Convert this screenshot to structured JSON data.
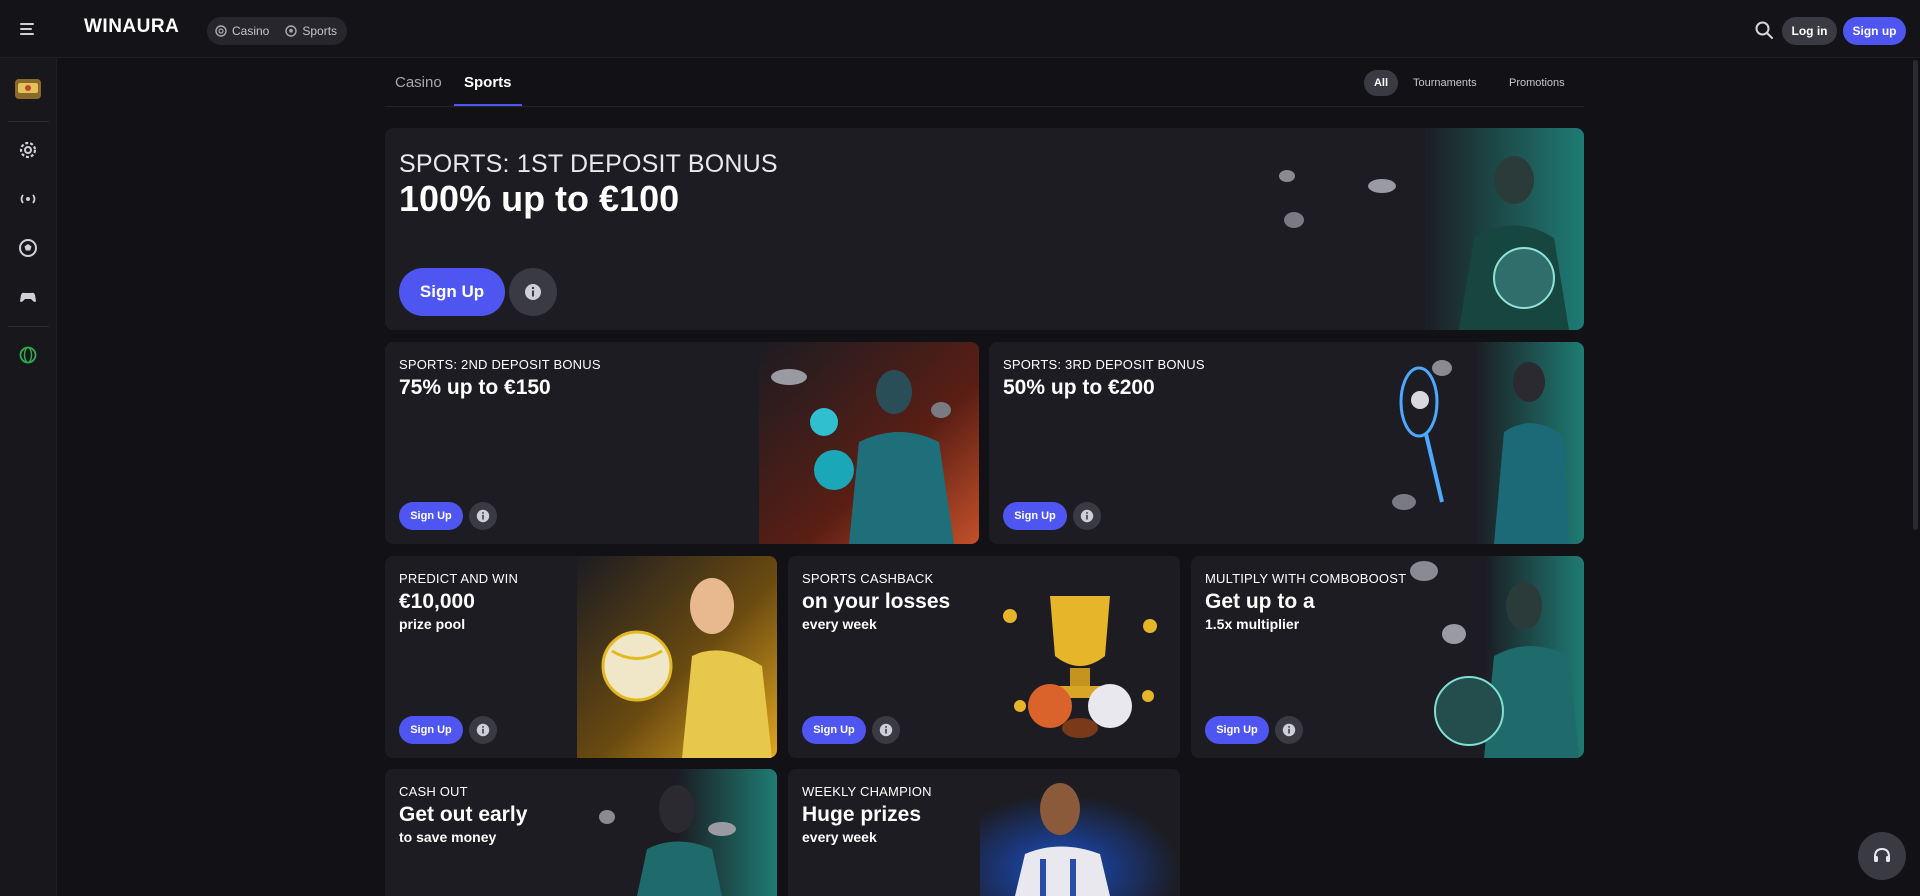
{
  "header": {
    "brand": "WINAURA",
    "nav": [
      {
        "label": "Casino",
        "icon": "casino-chip-icon"
      },
      {
        "label": "Sports",
        "icon": "soccer-ball-icon"
      }
    ],
    "login_label": "Log in",
    "signup_label": "Sign up"
  },
  "sidebar": {
    "items": [
      {
        "icon": "casino-badge-icon"
      },
      {
        "icon": "gear-icon"
      },
      {
        "icon": "live-broadcast-icon"
      },
      {
        "icon": "soccer-ball-icon"
      },
      {
        "icon": "gamepad-icon"
      },
      {
        "icon": "globe-icon"
      }
    ]
  },
  "tabs": {
    "items": [
      "Casino",
      "Sports"
    ],
    "active": "Sports"
  },
  "filters": [
    "All",
    "Tournaments",
    "Promotions"
  ],
  "cards": [
    {
      "eyebrow": "SPORTS: 1ST DEPOSIT BONUS",
      "headline": "100% up to €100",
      "sub": "",
      "cta": "Sign Up"
    },
    {
      "eyebrow": "SPORTS: 2ND DEPOSIT BONUS",
      "headline": "75% up to €150",
      "sub": "",
      "cta": "Sign Up"
    },
    {
      "eyebrow": "SPORTS: 3RD DEPOSIT BONUS",
      "headline": "50% up to €200",
      "sub": "",
      "cta": "Sign Up"
    },
    {
      "eyebrow": "PREDICT AND WIN",
      "headline": "€10,000",
      "sub": "prize pool",
      "cta": "Sign Up"
    },
    {
      "eyebrow": "SPORTS CASHBACK",
      "headline": "on your losses",
      "sub": "every week",
      "cta": "Sign Up"
    },
    {
      "eyebrow": "MULTIPLY WITH COMBOBOOST",
      "headline": "Get up to a",
      "sub": "1.5x multiplier",
      "cta": "Sign Up"
    },
    {
      "eyebrow": "CASH OUT",
      "headline": "Get out early",
      "sub": "to save money",
      "cta": ""
    },
    {
      "eyebrow": "WEEKLY CHAMPION",
      "headline": "Huge prizes",
      "sub": "every week",
      "cta": ""
    }
  ],
  "colors": {
    "accent": "#4f55f0",
    "background": "#121216",
    "card": "#1c1c22"
  }
}
